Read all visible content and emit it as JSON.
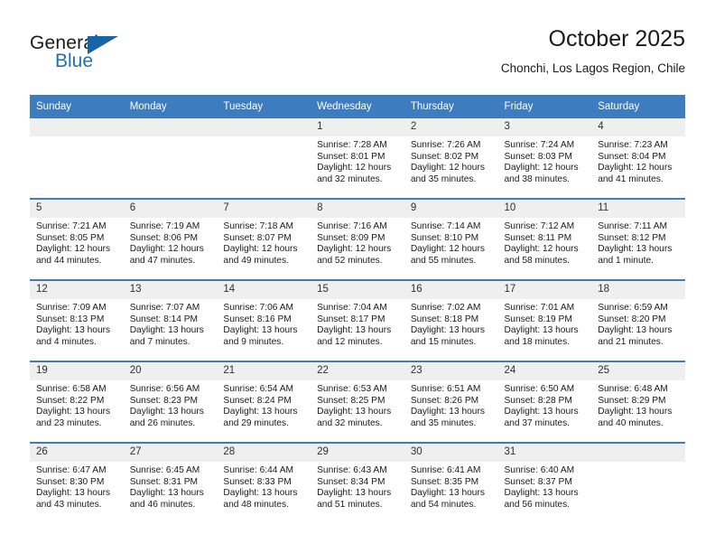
{
  "brand": {
    "name_part1": "General",
    "name_part2": "Blue"
  },
  "header": {
    "title": "October 2025",
    "location": "Chonchi, Los Lagos Region, Chile"
  },
  "weekdays": [
    "Sunday",
    "Monday",
    "Tuesday",
    "Wednesday",
    "Thursday",
    "Friday",
    "Saturday"
  ],
  "colors": {
    "header_blue": "#3d7cbf",
    "band_gray": "#efefef",
    "logo_blue": "#1f6fb8",
    "text": "#1a1a1a"
  },
  "weeks": [
    [
      {
        "day": "",
        "sunrise": "",
        "sunset": "",
        "daylight": ""
      },
      {
        "day": "",
        "sunrise": "",
        "sunset": "",
        "daylight": ""
      },
      {
        "day": "",
        "sunrise": "",
        "sunset": "",
        "daylight": ""
      },
      {
        "day": "1",
        "sunrise": "Sunrise: 7:28 AM",
        "sunset": "Sunset: 8:01 PM",
        "daylight": "Daylight: 12 hours and 32 minutes."
      },
      {
        "day": "2",
        "sunrise": "Sunrise: 7:26 AM",
        "sunset": "Sunset: 8:02 PM",
        "daylight": "Daylight: 12 hours and 35 minutes."
      },
      {
        "day": "3",
        "sunrise": "Sunrise: 7:24 AM",
        "sunset": "Sunset: 8:03 PM",
        "daylight": "Daylight: 12 hours and 38 minutes."
      },
      {
        "day": "4",
        "sunrise": "Sunrise: 7:23 AM",
        "sunset": "Sunset: 8:04 PM",
        "daylight": "Daylight: 12 hours and 41 minutes."
      }
    ],
    [
      {
        "day": "5",
        "sunrise": "Sunrise: 7:21 AM",
        "sunset": "Sunset: 8:05 PM",
        "daylight": "Daylight: 12 hours and 44 minutes."
      },
      {
        "day": "6",
        "sunrise": "Sunrise: 7:19 AM",
        "sunset": "Sunset: 8:06 PM",
        "daylight": "Daylight: 12 hours and 47 minutes."
      },
      {
        "day": "7",
        "sunrise": "Sunrise: 7:18 AM",
        "sunset": "Sunset: 8:07 PM",
        "daylight": "Daylight: 12 hours and 49 minutes."
      },
      {
        "day": "8",
        "sunrise": "Sunrise: 7:16 AM",
        "sunset": "Sunset: 8:09 PM",
        "daylight": "Daylight: 12 hours and 52 minutes."
      },
      {
        "day": "9",
        "sunrise": "Sunrise: 7:14 AM",
        "sunset": "Sunset: 8:10 PM",
        "daylight": "Daylight: 12 hours and 55 minutes."
      },
      {
        "day": "10",
        "sunrise": "Sunrise: 7:12 AM",
        "sunset": "Sunset: 8:11 PM",
        "daylight": "Daylight: 12 hours and 58 minutes."
      },
      {
        "day": "11",
        "sunrise": "Sunrise: 7:11 AM",
        "sunset": "Sunset: 8:12 PM",
        "daylight": "Daylight: 13 hours and 1 minute."
      }
    ],
    [
      {
        "day": "12",
        "sunrise": "Sunrise: 7:09 AM",
        "sunset": "Sunset: 8:13 PM",
        "daylight": "Daylight: 13 hours and 4 minutes."
      },
      {
        "day": "13",
        "sunrise": "Sunrise: 7:07 AM",
        "sunset": "Sunset: 8:14 PM",
        "daylight": "Daylight: 13 hours and 7 minutes."
      },
      {
        "day": "14",
        "sunrise": "Sunrise: 7:06 AM",
        "sunset": "Sunset: 8:16 PM",
        "daylight": "Daylight: 13 hours and 9 minutes."
      },
      {
        "day": "15",
        "sunrise": "Sunrise: 7:04 AM",
        "sunset": "Sunset: 8:17 PM",
        "daylight": "Daylight: 13 hours and 12 minutes."
      },
      {
        "day": "16",
        "sunrise": "Sunrise: 7:02 AM",
        "sunset": "Sunset: 8:18 PM",
        "daylight": "Daylight: 13 hours and 15 minutes."
      },
      {
        "day": "17",
        "sunrise": "Sunrise: 7:01 AM",
        "sunset": "Sunset: 8:19 PM",
        "daylight": "Daylight: 13 hours and 18 minutes."
      },
      {
        "day": "18",
        "sunrise": "Sunrise: 6:59 AM",
        "sunset": "Sunset: 8:20 PM",
        "daylight": "Daylight: 13 hours and 21 minutes."
      }
    ],
    [
      {
        "day": "19",
        "sunrise": "Sunrise: 6:58 AM",
        "sunset": "Sunset: 8:22 PM",
        "daylight": "Daylight: 13 hours and 23 minutes."
      },
      {
        "day": "20",
        "sunrise": "Sunrise: 6:56 AM",
        "sunset": "Sunset: 8:23 PM",
        "daylight": "Daylight: 13 hours and 26 minutes."
      },
      {
        "day": "21",
        "sunrise": "Sunrise: 6:54 AM",
        "sunset": "Sunset: 8:24 PM",
        "daylight": "Daylight: 13 hours and 29 minutes."
      },
      {
        "day": "22",
        "sunrise": "Sunrise: 6:53 AM",
        "sunset": "Sunset: 8:25 PM",
        "daylight": "Daylight: 13 hours and 32 minutes."
      },
      {
        "day": "23",
        "sunrise": "Sunrise: 6:51 AM",
        "sunset": "Sunset: 8:26 PM",
        "daylight": "Daylight: 13 hours and 35 minutes."
      },
      {
        "day": "24",
        "sunrise": "Sunrise: 6:50 AM",
        "sunset": "Sunset: 8:28 PM",
        "daylight": "Daylight: 13 hours and 37 minutes."
      },
      {
        "day": "25",
        "sunrise": "Sunrise: 6:48 AM",
        "sunset": "Sunset: 8:29 PM",
        "daylight": "Daylight: 13 hours and 40 minutes."
      }
    ],
    [
      {
        "day": "26",
        "sunrise": "Sunrise: 6:47 AM",
        "sunset": "Sunset: 8:30 PM",
        "daylight": "Daylight: 13 hours and 43 minutes."
      },
      {
        "day": "27",
        "sunrise": "Sunrise: 6:45 AM",
        "sunset": "Sunset: 8:31 PM",
        "daylight": "Daylight: 13 hours and 46 minutes."
      },
      {
        "day": "28",
        "sunrise": "Sunrise: 6:44 AM",
        "sunset": "Sunset: 8:33 PM",
        "daylight": "Daylight: 13 hours and 48 minutes."
      },
      {
        "day": "29",
        "sunrise": "Sunrise: 6:43 AM",
        "sunset": "Sunset: 8:34 PM",
        "daylight": "Daylight: 13 hours and 51 minutes."
      },
      {
        "day": "30",
        "sunrise": "Sunrise: 6:41 AM",
        "sunset": "Sunset: 8:35 PM",
        "daylight": "Daylight: 13 hours and 54 minutes."
      },
      {
        "day": "31",
        "sunrise": "Sunrise: 6:40 AM",
        "sunset": "Sunset: 8:37 PM",
        "daylight": "Daylight: 13 hours and 56 minutes."
      },
      {
        "day": "",
        "sunrise": "",
        "sunset": "",
        "daylight": ""
      }
    ]
  ]
}
